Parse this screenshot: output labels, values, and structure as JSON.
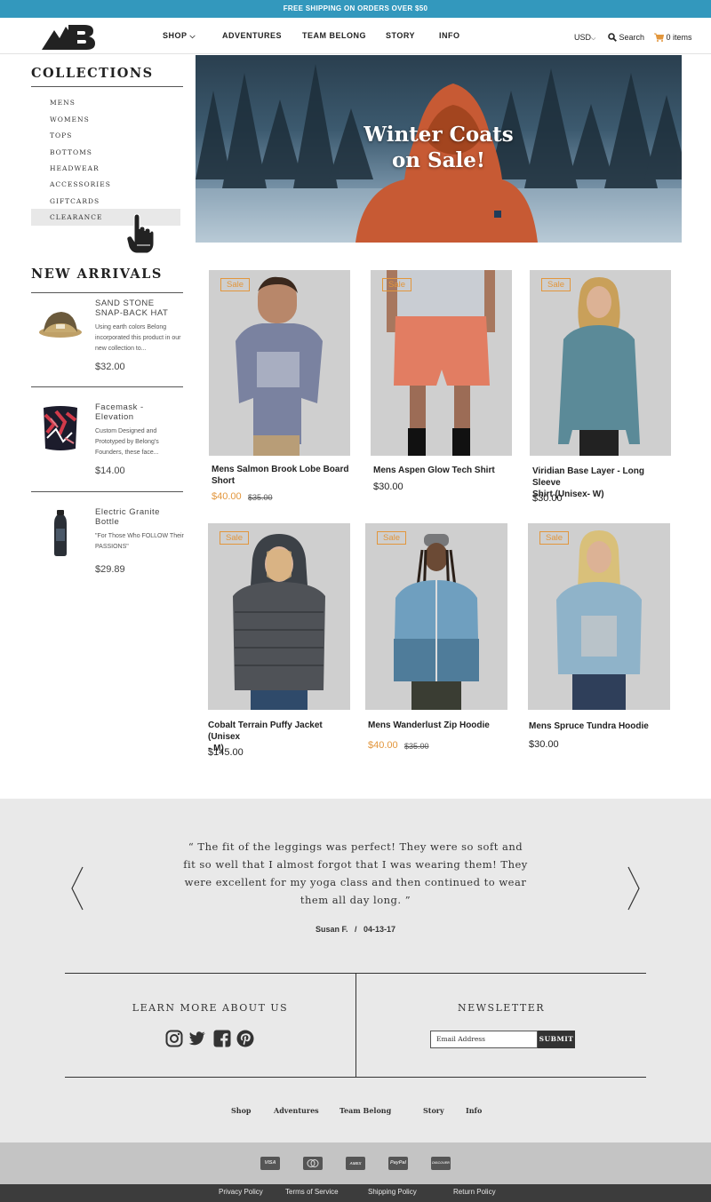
{
  "announcement": "FREE SHIPPING ON ORDERS OVER $50",
  "header": {
    "nav": [
      "SHOP",
      "ADVENTURES",
      "TEAM BELONG",
      "STORY",
      "INFO"
    ],
    "currency": "USD",
    "search_label": "Search",
    "cart_label": "0 items",
    "colors": {
      "accent": "#3398bd",
      "sale": "#e2963c"
    }
  },
  "sidebar": {
    "collections_title": "COLLECTIONS",
    "collections": [
      "MENS",
      "WOMENS",
      "TOPS",
      "BOTTOMS",
      "HEADWEAR",
      "ACCESSORIES",
      "GIFTCARDS",
      "CLEARANCE"
    ],
    "new_arrivals_title": "NEW ARRIVALS",
    "new_arrivals": [
      {
        "name": "SAND STONE SNAP-BACK HAT",
        "desc": "Using earth colors Belong incorporated this product in our new collection to...",
        "price": "$32.00"
      },
      {
        "name": "Facemask - Elevation",
        "desc": "Custom Designed and Prototyped by Belong's Founders, these face...",
        "price": "$14.00"
      },
      {
        "name": "Electric Granite Bottle",
        "desc": "\"For Those Who FOLLOW Their PASSIONS\"",
        "price": "$29.89"
      }
    ]
  },
  "hero": {
    "title_line1": "Winter Coats",
    "title_line2": "on Sale!"
  },
  "products": [
    {
      "name_line1": "Mens Salmon Brook Lobe Board",
      "name_line2": "Short",
      "price": "$40.00",
      "old_price": "$35.00",
      "sale": true,
      "badge": "Sale"
    },
    {
      "name_line1": "Mens Aspen Glow Tech Shirt",
      "name_line2": "",
      "price": "$30.00",
      "old_price": "",
      "sale": true,
      "badge": "Sale"
    },
    {
      "name_line1": "Viridian Base Layer - Long Sleeve",
      "name_line2": "Shirt (Unisex- W)",
      "price": "$30.00",
      "old_price": "",
      "sale": true,
      "badge": "Sale"
    },
    {
      "name_line1": "Cobalt Terrain Puffy Jacket (Unisex",
      "name_line2": "- M)",
      "price": "$145.00",
      "old_price": "",
      "sale": true,
      "badge": "Sale"
    },
    {
      "name_line1": "Mens Wanderlust Zip Hoodie",
      "name_line2": "",
      "price": "$40.00",
      "old_price": "$35.00",
      "sale": true,
      "badge": "Sale"
    },
    {
      "name_line1": "Mens Spruce Tundra Hoodie",
      "name_line2": "",
      "price": "$30.00",
      "old_price": "",
      "sale": true,
      "badge": "Sale"
    }
  ],
  "testimonial": {
    "lines": [
      "“ The fit of the leggings was perfect! They were so soft and",
      "fit so well that I almost forgot that I was wearing them! They",
      "were excellent for my yoga class and then continued to wear",
      "them all day long. ”"
    ],
    "author": "Susan F.   /   04-13-17"
  },
  "footer": {
    "learn_title": "LEARN MORE ABOUT US",
    "social_icons": [
      "instagram-icon",
      "twitter-icon",
      "facebook-icon",
      "pinterest-icon"
    ],
    "newsletter_title": "NEWSLETTER",
    "newsletter_placeholder": "Email Address",
    "submit_label": "SUBMIT",
    "nav": [
      "Shop",
      "Adventures",
      "Team Belong",
      "Story",
      "Info"
    ],
    "payments": [
      "VISA",
      "mastercard",
      "AMEX",
      "PayPal",
      "DISCOVER"
    ],
    "legal": [
      "Privacy Policy",
      "Terms of Service",
      "Shipping Policy",
      "Return Policy"
    ]
  }
}
